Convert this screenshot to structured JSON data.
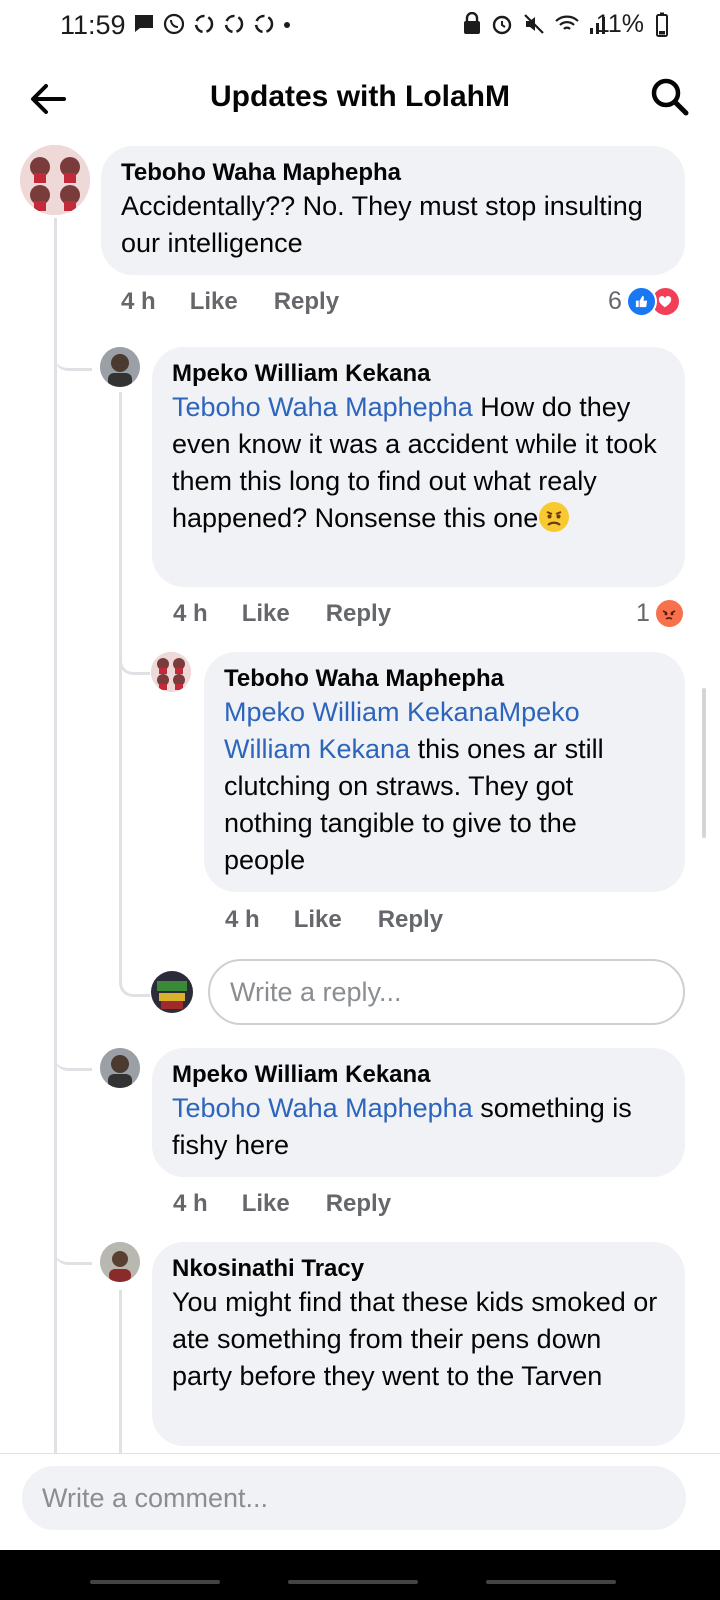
{
  "status_bar": {
    "time": "11:59",
    "battery": "11%",
    "left_icons": [
      "chat-bubble-icon",
      "whatsapp-icon",
      "recycle-icon",
      "recycle-icon",
      "recycle-icon",
      "dot-icon"
    ],
    "right_icons": [
      "lock-icon",
      "alarm-icon",
      "mute-icon",
      "wifi-icon",
      "signal-icon",
      "battery-icon"
    ]
  },
  "header": {
    "title": "Updates with LolahM"
  },
  "comments": [
    {
      "author": "Teboho Waha Maphepha",
      "text": "Accidentally?? No. They must stop insulting our intelligence",
      "time": "4 h",
      "like": "Like",
      "reply": "Reply",
      "reactions": {
        "count": "6",
        "types": [
          "like",
          "love"
        ]
      }
    },
    {
      "author": "Mpeko William Kekana",
      "mention": "Teboho Waha Maphepha",
      "text": " How do they even know it was a accident while it took them this long to find out what realy happened? Nonsense this one",
      "emoji": "frowning-face",
      "time": "4 h",
      "like": "Like",
      "reply": "Reply",
      "reactions": {
        "count": "1",
        "types": [
          "angry"
        ]
      }
    },
    {
      "author": "Teboho Waha Maphepha",
      "mention": "Mpeko William KekanaMpeko William Kekana",
      "text": " this ones ar still clutching on straws. They got nothing tangible to give to the people",
      "time": "4 h",
      "like": "Like",
      "reply": "Reply"
    },
    {
      "author": "Mpeko William Kekana",
      "mention": "Teboho Waha Maphepha",
      "text": " something is fishy here",
      "time": "4 h",
      "like": "Like",
      "reply": "Reply"
    },
    {
      "author": "Nkosinathi Tracy",
      "text": "You might find that these kids smoked or ate something from their pens down party before they went to the Tarven"
    }
  ],
  "reply_input": {
    "placeholder": "Write a reply..."
  },
  "comment_input": {
    "placeholder": "Write a comment..."
  },
  "colors": {
    "mention": "#2d64bc",
    "bubble": "#f0f2f5",
    "meta": "#65676b",
    "like_blue": "#1877f2",
    "love_red": "#f33e58",
    "angry_orange": "#f7714c"
  }
}
